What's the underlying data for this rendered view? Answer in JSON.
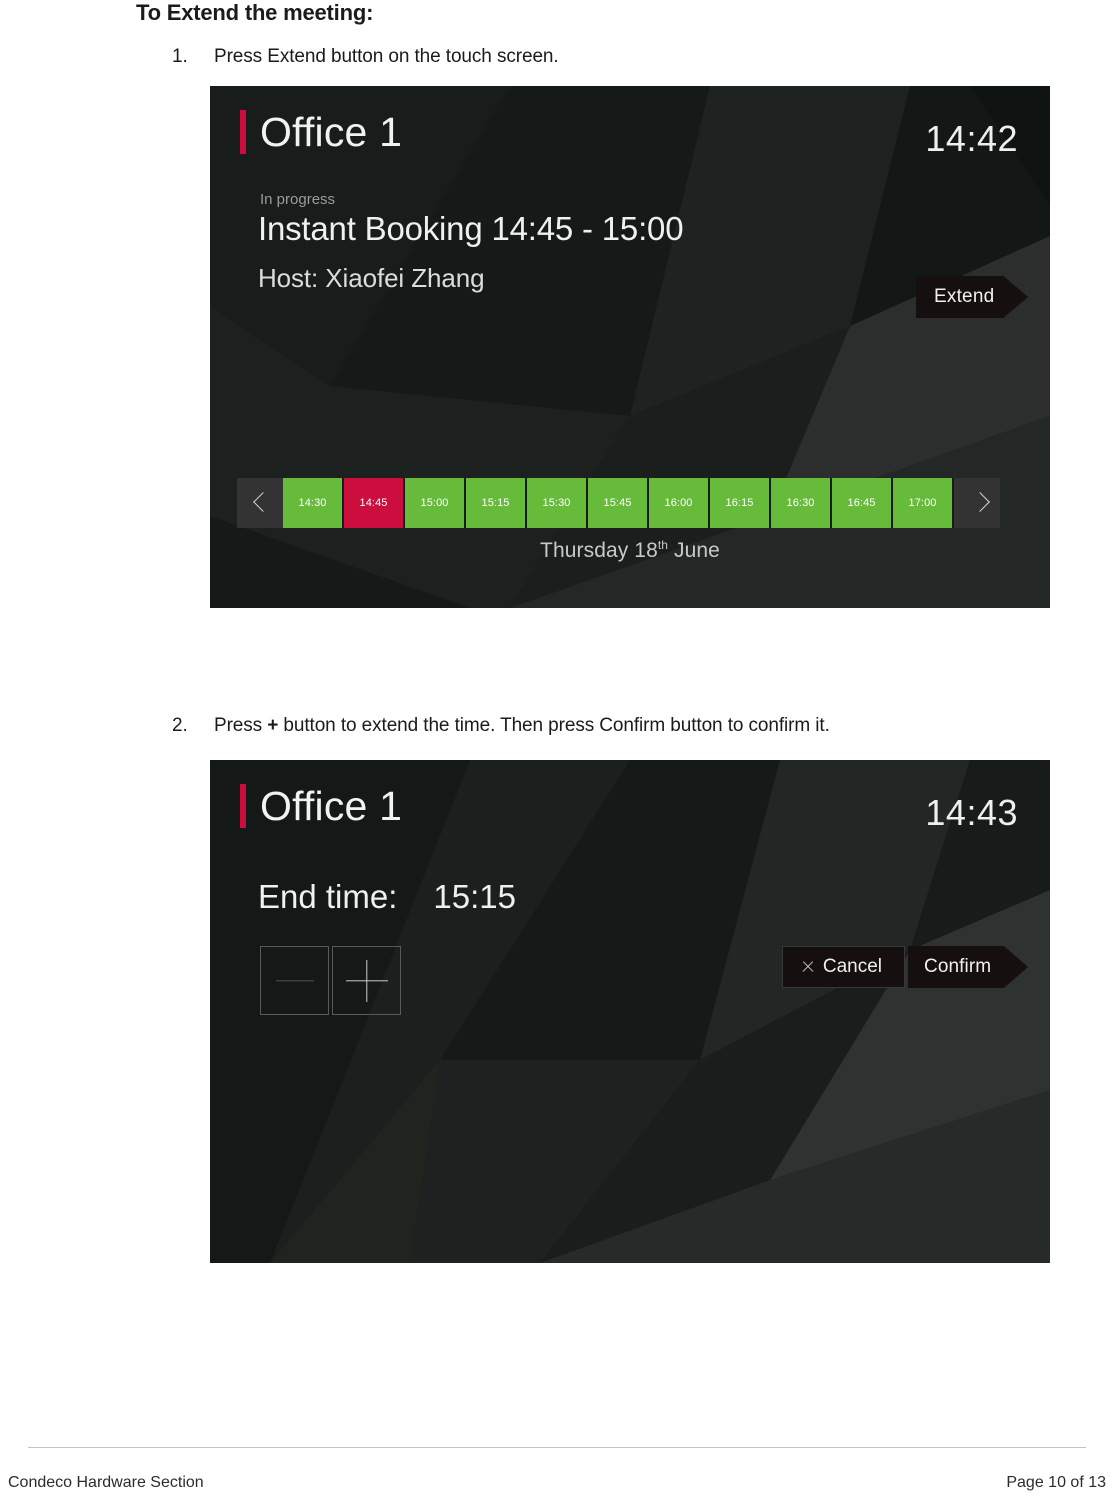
{
  "document": {
    "heading": "To Extend the meeting:",
    "steps": [
      {
        "number": "1.",
        "text": "Press Extend button on the touch screen."
      },
      {
        "number": "2.",
        "text_before": "Press ",
        "bold": "+",
        "text_after": " button to extend the time.  Then press Confirm button to confirm it."
      }
    ],
    "footer": {
      "left": "Condeco Hardware Section",
      "right": "Page 10 of 13"
    }
  },
  "colors": {
    "accent_red": "#cc0e3f",
    "slot_free_green": "#66bb3a",
    "slot_busy_red": "#cc0e3f",
    "screen_background": "#111513"
  },
  "screen1": {
    "room_name": "Office 1",
    "clock": "14:42",
    "status": "In progress",
    "booking_title": "Instant Booking 14:45 - 15:00",
    "host": "Host: Xiaofei Zhang",
    "extend_button": "Extend",
    "prev_icon": "chevron-left-icon",
    "next_icon": "chevron-right-icon",
    "date_day": "Thursday 18",
    "date_suffix": "th",
    "date_month": " June",
    "timeline": [
      {
        "time": "14:30",
        "state": "free"
      },
      {
        "time": "14:45",
        "state": "busy"
      },
      {
        "time": "15:00",
        "state": "free"
      },
      {
        "time": "15:15",
        "state": "free"
      },
      {
        "time": "15:30",
        "state": "free"
      },
      {
        "time": "15:45",
        "state": "free"
      },
      {
        "time": "16:00",
        "state": "free"
      },
      {
        "time": "16:15",
        "state": "free"
      },
      {
        "time": "16:30",
        "state": "free"
      },
      {
        "time": "16:45",
        "state": "free"
      },
      {
        "time": "17:00",
        "state": "free"
      }
    ]
  },
  "screen2": {
    "room_name": "Office 1",
    "clock": "14:43",
    "end_time_label": "End time:",
    "end_time_value": "15:15",
    "minus_button": "minus-icon",
    "plus_button": "plus-icon",
    "cancel_button": "Cancel",
    "cancel_icon": "close-x-icon",
    "confirm_button": "Confirm"
  }
}
